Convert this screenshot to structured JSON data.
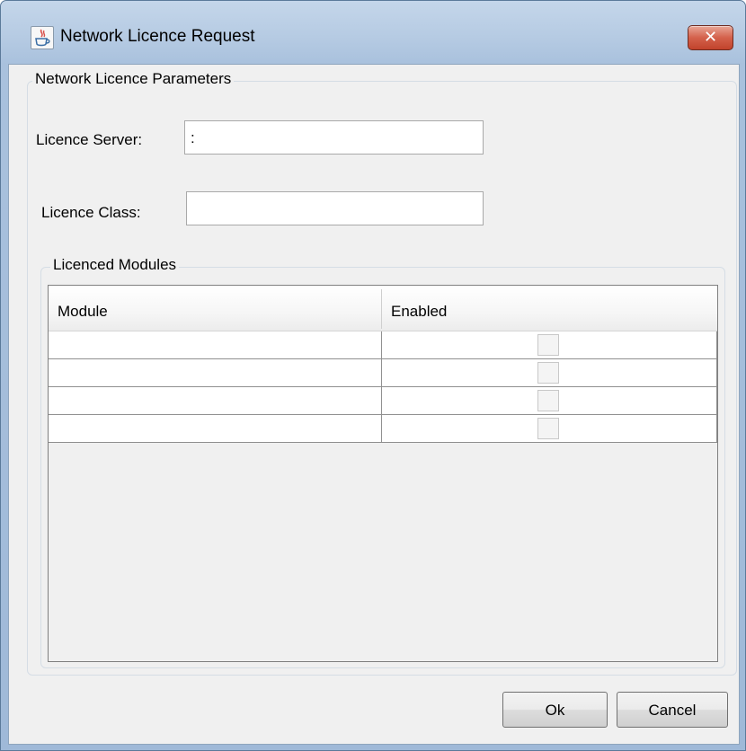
{
  "window": {
    "title": "Network Licence Request",
    "close_glyph": "✕",
    "icon": "java-cup-icon"
  },
  "params_group": {
    "legend": "Network Licence Parameters",
    "licence_server_label": "Licence Server:",
    "licence_server_value": ":",
    "licence_class_label": "Licence Class:",
    "licence_class_value": ""
  },
  "modules_group": {
    "legend": "Licenced Modules",
    "columns": [
      "Module",
      "Enabled"
    ],
    "rows": [
      {
        "module": "",
        "enabled": false
      },
      {
        "module": "",
        "enabled": false
      },
      {
        "module": "",
        "enabled": false
      },
      {
        "module": "",
        "enabled": false
      }
    ]
  },
  "buttons": {
    "ok_label": "Ok",
    "cancel_label": "Cancel"
  },
  "colors": {
    "close_button": "#c8452f",
    "title_bar": "#b6cbe3",
    "dialog_bg": "#f0f0f0"
  }
}
